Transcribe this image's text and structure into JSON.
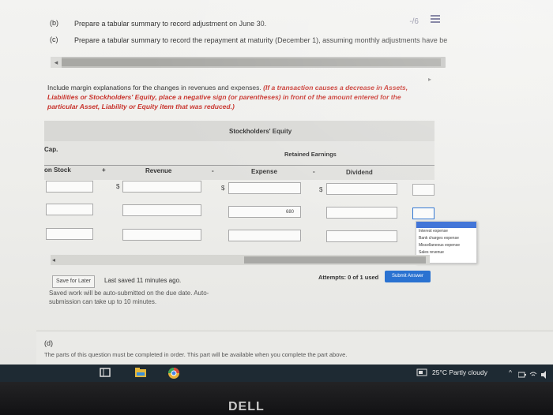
{
  "header": {
    "score": "-/6"
  },
  "parts": {
    "b_label": "(b)",
    "b_text": "Prepare a tabular summary to record adjustment on June 30.",
    "c_label": "(c)",
    "c_text": "Prepare a tabular summary to record the repayment at maturity (December 1), assuming monthly adjustments have be"
  },
  "instructions": {
    "plain": "Include margin explanations for the changes in revenues and expenses.",
    "red": "(If a transaction causes a decrease in Assets, Liabilities or Stockholders' Equity, place a negative sign (or parentheses) in front of the amount entered for the particular Asset, Liability or Equity item that was reduced.)"
  },
  "table": {
    "group_header": "Stockholders' Equity",
    "left_header": "Cap.",
    "retained_header": "Retained Earnings",
    "columns": {
      "stock": "on Stock",
      "plus": "+",
      "revenue": "Revenue",
      "minus1": "-",
      "expense": "Expense",
      "minus2": "-",
      "dividend": "Dividend"
    },
    "currency": "$",
    "expense_value": "680"
  },
  "dropdown": {
    "options": [
      "Interest expense",
      "Bank charges expense",
      "Miscellaneous expense",
      "Sales revenue"
    ]
  },
  "footer": {
    "save_label": "Save for Later",
    "last_saved": "Last saved 11 minutes ago.",
    "auto_submit": "Saved work will be auto-submitted on the due date. Auto-submission can take up to 10 minutes.",
    "attempts": "Attempts: 0 of 1 used",
    "submit_label": "Submit Answer"
  },
  "part_d": {
    "label": "(d)",
    "text": "The parts of this question must be completed in order. This part will be available when you complete the part above."
  },
  "taskbar": {
    "weather": "25°C  Partly cloudy"
  },
  "bezel": {
    "brand": "DELL"
  }
}
